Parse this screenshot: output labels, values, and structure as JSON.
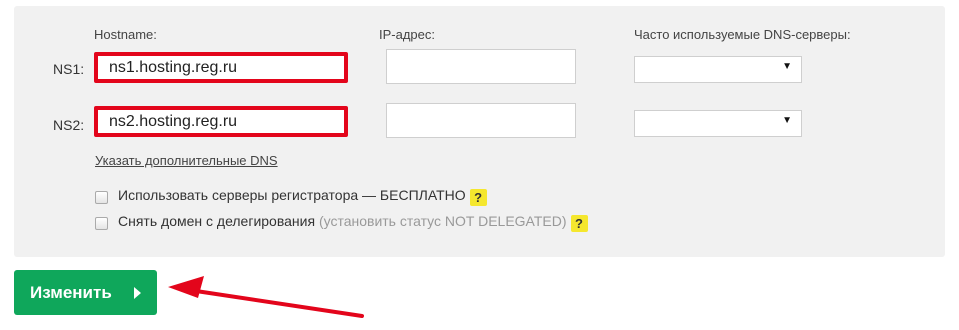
{
  "columns": {
    "hostname": "Hostname:",
    "ip": "IP-адрес:",
    "frequent_dns": "Часто используемые DNS-серверы:"
  },
  "rows": [
    {
      "label": "NS1:",
      "hostname": "ns1.hosting.reg.ru",
      "ip": "",
      "dns_selected": ""
    },
    {
      "label": "NS2:",
      "hostname": "ns2.hosting.reg.ru",
      "ip": "",
      "dns_selected": ""
    }
  ],
  "more_dns_link": "Указать дополнительные DNS",
  "options": {
    "registrar_servers": {
      "label": "Использовать серверы регистратора — БЕСПЛАТНО",
      "checked": false
    },
    "undelegate": {
      "label": "Снять домен с делегирования",
      "note": "(установить статус NOT DELEGATED)",
      "checked": false
    }
  },
  "help_badge": "?",
  "select_caret": "▼",
  "submit": {
    "label": "Изменить"
  },
  "colors": {
    "highlight_red": "#e3051b",
    "submit_green": "#0fa75b",
    "help_yellow": "#f5e72e",
    "panel_gray": "#f1f1f1"
  },
  "icons": {
    "select_caret": "chevron-down-icon",
    "button_arrow": "play-arrow-icon",
    "help": "question-icon",
    "annotation": "annotation-arrow-icon"
  }
}
